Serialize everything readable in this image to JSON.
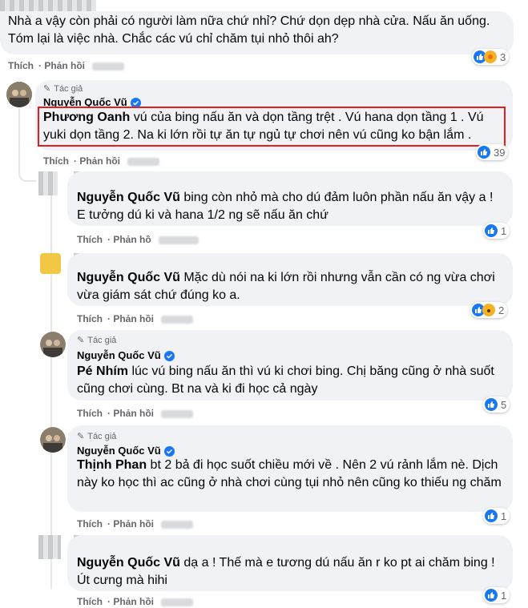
{
  "comments": [
    {
      "text": "Nhà a vậy còn phải có người làm nữa chứ nhỉ? Chứ dọn dẹp nhà cửa. Nấu ăn uống. Tóm lại là việc nhà. Chắc các vú chỉ chăm tụi nhỏ thôi ah?",
      "actions": [
        "Thích",
        "Phản hồi"
      ],
      "reactions": "3"
    },
    {
      "author_tag": "Tác giả",
      "author": "Nguyễn Quốc Vũ",
      "mention": "Phương Oanh",
      "text": " vú của bing nấu ăn và dọn tầng trệt . Vú hana dọn tầng 1 . Vú yuki dọn tầng 2. Na ki lớn rồi tự ăn tự ngủ tự chơi nên vú cũng ko bận lắm .",
      "actions": [
        "Thích",
        "Phản hồi"
      ],
      "reactions": "39"
    },
    {
      "mention": "Nguyễn Quốc Vũ",
      "text": " bing còn nhỏ mà cho dú đảm luôn phần nấu ăn vậy a ! E tưởng dú ki và hana 1/2 ng sẽ nấu ăn chứ",
      "actions": [
        "Thích",
        "Phản hồ"
      ],
      "reactions": "1"
    },
    {
      "mention": "Nguyễn Quốc Vũ",
      "text": " Mặc dù nói na ki lớn rồi nhưng vẫn cần có ng vừa chơi vừa giám sát chứ đúng ko a.",
      "actions": [
        "Thích",
        "Phản hồi"
      ],
      "reactions": "2"
    },
    {
      "author_tag": "Tác giả",
      "author": "Nguyễn Quốc Vũ",
      "mention": "Pé Nhím",
      "text": " lúc vú bing nấu ăn thì vú ki chơi bing. Chị băng cũng ở nhà suốt cũng chơi cùng. Bt na và ki đi học cả ngày",
      "actions": [
        "Thích",
        "Phản hồi"
      ],
      "reactions": "5"
    },
    {
      "author_tag": "Tác giả",
      "author": "Nguyễn Quốc Vũ",
      "mention": "Thịnh Phan",
      "text": " bt 2 bả đi học suốt chiều mới về . Nên 2 vú rảnh lắm nè. Dịch này ko học thì ac cũng ở nhà chơi cùng tụi nhỏ nên cũng ko thiếu ng chăm",
      "actions": [
        "Thích",
        "Phản hồi"
      ],
      "reactions": "1"
    },
    {
      "mention": "Nguyễn Quốc Vũ",
      "text": " dạ a ! Thế mà e tương dú nấu ăn r ko pt ai chăm bing ! Út cưng mà hihi",
      "actions": [
        "Thích",
        "Phản hồi"
      ],
      "reactions": "1"
    }
  ],
  "colors": {
    "accent": "#1877f2",
    "highlight_border": "#e02020",
    "bubble": "#f0f2f5",
    "muted": "#65676b"
  },
  "icons": [
    "pencil-icon",
    "verified-icon",
    "like-icon",
    "care-icon",
    "wow-icon"
  ]
}
